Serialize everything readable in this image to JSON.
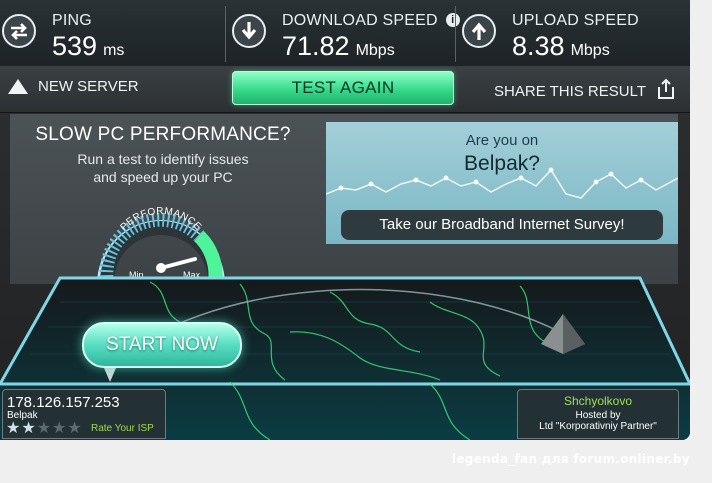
{
  "metrics": {
    "ping": {
      "label": "PING",
      "value": "539",
      "unit": "ms",
      "icon": "ping-arrows-icon"
    },
    "download": {
      "label": "DOWNLOAD SPEED",
      "value": "71.82",
      "unit": "Mbps",
      "icon": "download-arrow-icon"
    },
    "upload": {
      "label": "UPLOAD SPEED",
      "value": "8.38",
      "unit": "Mbps",
      "icon": "upload-arrow-icon"
    }
  },
  "actions": {
    "new_server": "NEW SERVER",
    "test_again": "TEST AGAIN",
    "share": "SHARE THIS RESULT"
  },
  "promo": {
    "title": "SLOW PC PERFORMANCE?",
    "line1": "Run a test to identify issues",
    "line2": "and speed up your PC",
    "gauge_label": "PERFORMANCE",
    "gauge_min": "Min",
    "gauge_max": "Max"
  },
  "survey": {
    "question": "Are you on",
    "isp": "Belpak?",
    "button": "Take our Broadband Internet Survey!"
  },
  "map": {
    "start_button": "START NOW"
  },
  "client": {
    "ip": "178.126.157.253",
    "isp": "Belpak",
    "rating_stars": 2,
    "rating_max": 5,
    "rate_link": "Rate Your ISP"
  },
  "server": {
    "city": "Shchyolkovo",
    "hosted_by": "Hosted by",
    "partner": "Ltd \"Korporativniy Partner\""
  },
  "watermark": "legenda_fan для forum.onliner.by",
  "colors": {
    "accent_green": "#37d98c",
    "map_line_green": "#3de07a",
    "survey_bg": "#8fc3ce"
  }
}
